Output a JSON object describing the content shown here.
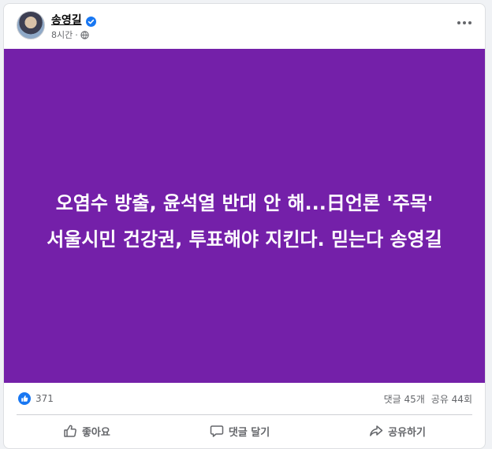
{
  "post": {
    "author": "송영길",
    "time": "8시간",
    "separator": "·",
    "headline": "오염수 방출, 윤석열 반대 안 해...日언론 '주목'",
    "subline": "서울시민 건강권, 투표해야 지킨다. 믿는다 송영길",
    "background_color": "#7420a9"
  },
  "counts": {
    "reactions": "371",
    "comments": "댓글 45개",
    "shares": "공유 44회"
  },
  "actions": {
    "like": "좋아요",
    "comment": "댓글 달기",
    "share": "공유하기"
  },
  "icons": [
    "verified-icon",
    "globe-icon",
    "more-icon",
    "like-reaction-icon",
    "thumbs-up-icon",
    "comment-icon",
    "share-icon"
  ]
}
